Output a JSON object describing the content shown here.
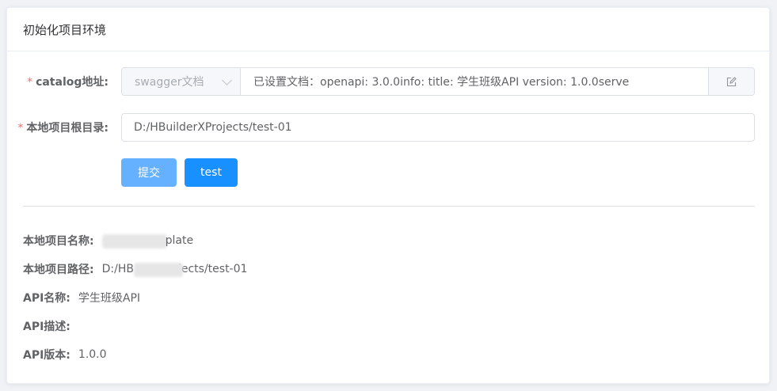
{
  "card": {
    "title": "初始化项目环境"
  },
  "form": {
    "catalog": {
      "required_mark": "*",
      "label": "catalog地址:",
      "select_value": "swagger文档",
      "input_value": "已设置文档：openapi: 3.0.0info:  title: 学生班级API  version: 1.0.0serve",
      "edit_icon": "edit-icon"
    },
    "root_dir": {
      "required_mark": "*",
      "label": "本地项目根目录:",
      "input_value": "D:/HBuilderXProjects/test-01"
    },
    "buttons": {
      "submit": "提交",
      "test": "test"
    }
  },
  "info": {
    "project_name": {
      "label": "本地项目名称:",
      "value_visible": "plate"
    },
    "project_path": {
      "label": "本地项目路径:",
      "value_start": "D:/HB",
      "value_end": "jects/test-01"
    },
    "api_name": {
      "label": "API名称:",
      "value": "学生班级API"
    },
    "api_desc": {
      "label": "API描述:",
      "value": ""
    },
    "api_version": {
      "label": "API版本:",
      "value": "1.0.0"
    }
  },
  "colors": {
    "required": "#f56c6c",
    "primary": "#1890ff",
    "primary_light": "#66b1ff"
  }
}
